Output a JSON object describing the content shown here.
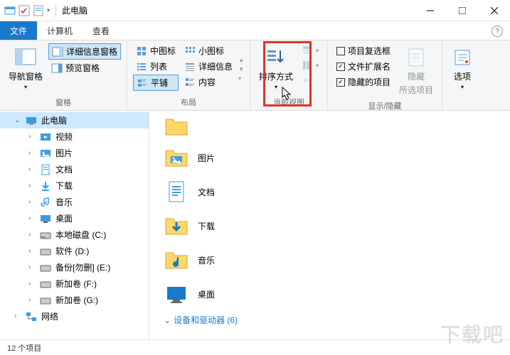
{
  "titlebar": {
    "title": "此电脑"
  },
  "tabs": {
    "file": "文件",
    "computer": "计算机",
    "view": "查看"
  },
  "ribbon": {
    "panes_group": "窗格",
    "nav_pane": "导航窗格",
    "detail_pane": "详细信息窗格",
    "preview_pane": "预览窗格",
    "layout_group": "布局",
    "medium_icons": "中图标",
    "list": "列表",
    "tiles": "平铺",
    "small_icons": "小图标",
    "details": "详细信息",
    "content": "内容",
    "current_view_group": "当前视图",
    "sort_by": "排序方式",
    "show_hide_group": "显示/隐藏",
    "item_checkboxes": "项目复选框",
    "file_ext": "文件扩展名",
    "hidden_items": "隐藏的项目",
    "hide_selected": "隐藏",
    "hide_selected2": "所选项目",
    "options": "选项"
  },
  "sidebar": {
    "this_pc": "此电脑",
    "videos": "视频",
    "pictures": "图片",
    "documents": "文档",
    "downloads": "下载",
    "music": "音乐",
    "desktop": "桌面",
    "local_c": "本地磁盘 (C:)",
    "local_d": "软件 (D:)",
    "local_e": "备份[勿删] (E:)",
    "local_f": "新加卷 (F:)",
    "local_g": "新加卷 (G:)",
    "network": "网络"
  },
  "main": {
    "pictures": "图片",
    "documents": "文档",
    "downloads": "下载",
    "music": "音乐",
    "desktop": "桌面",
    "devices_section": "设备和驱动器 (6)"
  },
  "status": {
    "count": "12 个项目"
  },
  "watermark": "下载吧"
}
